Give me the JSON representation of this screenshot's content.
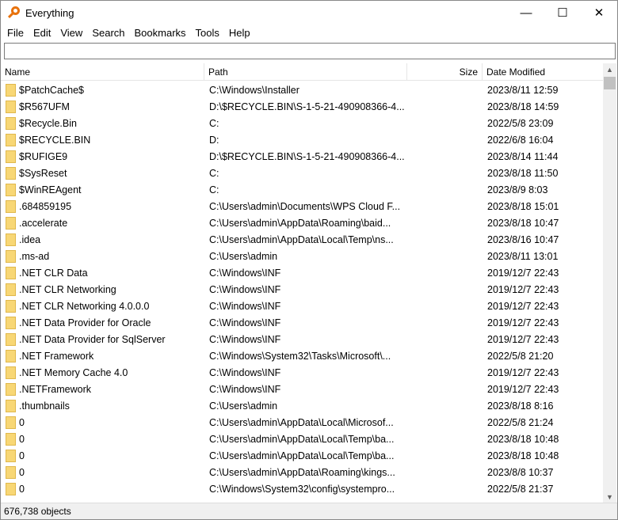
{
  "window": {
    "title": "Everything",
    "minimize": "—",
    "maximize": "☐",
    "close": "✕"
  },
  "menu": [
    "File",
    "Edit",
    "View",
    "Search",
    "Bookmarks",
    "Tools",
    "Help"
  ],
  "search": {
    "value": "",
    "placeholder": ""
  },
  "columns": {
    "name": "Name",
    "path": "Path",
    "size": "Size",
    "date": "Date Modified"
  },
  "rows": [
    {
      "name": "$PatchCache$",
      "path": "C:\\Windows\\Installer",
      "size": "",
      "date": "2023/8/11 12:59"
    },
    {
      "name": "$R567UFM",
      "path": "D:\\$RECYCLE.BIN\\S-1-5-21-490908366-4...",
      "size": "",
      "date": "2023/8/18 14:59"
    },
    {
      "name": "$Recycle.Bin",
      "path": "C:",
      "size": "",
      "date": "2022/5/8 23:09"
    },
    {
      "name": "$RECYCLE.BIN",
      "path": "D:",
      "size": "",
      "date": "2022/6/8 16:04"
    },
    {
      "name": "$RUFIGE9",
      "path": "D:\\$RECYCLE.BIN\\S-1-5-21-490908366-4...",
      "size": "",
      "date": "2023/8/14 11:44"
    },
    {
      "name": "$SysReset",
      "path": "C:",
      "size": "",
      "date": "2023/8/18 11:50"
    },
    {
      "name": "$WinREAgent",
      "path": "C:",
      "size": "",
      "date": "2023/8/9 8:03"
    },
    {
      "name": ".684859195",
      "path": "C:\\Users\\admin\\Documents\\WPS Cloud F...",
      "size": "",
      "date": "2023/8/18 15:01"
    },
    {
      "name": ".accelerate",
      "path": "C:\\Users\\admin\\AppData\\Roaming\\baid...",
      "size": "",
      "date": "2023/8/18 10:47"
    },
    {
      "name": ".idea",
      "path": "C:\\Users\\admin\\AppData\\Local\\Temp\\ns...",
      "size": "",
      "date": "2023/8/16 10:47"
    },
    {
      "name": ".ms-ad",
      "path": "C:\\Users\\admin",
      "size": "",
      "date": "2023/8/11 13:01"
    },
    {
      "name": ".NET CLR Data",
      "path": "C:\\Windows\\INF",
      "size": "",
      "date": "2019/12/7 22:43"
    },
    {
      "name": ".NET CLR Networking",
      "path": "C:\\Windows\\INF",
      "size": "",
      "date": "2019/12/7 22:43"
    },
    {
      "name": ".NET CLR Networking 4.0.0.0",
      "path": "C:\\Windows\\INF",
      "size": "",
      "date": "2019/12/7 22:43"
    },
    {
      "name": ".NET Data Provider for Oracle",
      "path": "C:\\Windows\\INF",
      "size": "",
      "date": "2019/12/7 22:43"
    },
    {
      "name": ".NET Data Provider for SqlServer",
      "path": "C:\\Windows\\INF",
      "size": "",
      "date": "2019/12/7 22:43"
    },
    {
      "name": ".NET Framework",
      "path": "C:\\Windows\\System32\\Tasks\\Microsoft\\...",
      "size": "",
      "date": "2022/5/8 21:20"
    },
    {
      "name": ".NET Memory Cache 4.0",
      "path": "C:\\Windows\\INF",
      "size": "",
      "date": "2019/12/7 22:43"
    },
    {
      "name": ".NETFramework",
      "path": "C:\\Windows\\INF",
      "size": "",
      "date": "2019/12/7 22:43"
    },
    {
      "name": ".thumbnails",
      "path": "C:\\Users\\admin",
      "size": "",
      "date": "2023/8/18 8:16"
    },
    {
      "name": "0",
      "path": "C:\\Users\\admin\\AppData\\Local\\Microsof...",
      "size": "",
      "date": "2022/5/8 21:24"
    },
    {
      "name": "0",
      "path": "C:\\Users\\admin\\AppData\\Local\\Temp\\ba...",
      "size": "",
      "date": "2023/8/18 10:48"
    },
    {
      "name": "0",
      "path": "C:\\Users\\admin\\AppData\\Local\\Temp\\ba...",
      "size": "",
      "date": "2023/8/18 10:48"
    },
    {
      "name": "0",
      "path": "C:\\Users\\admin\\AppData\\Roaming\\kings...",
      "size": "",
      "date": "2023/8/8 10:37"
    },
    {
      "name": "0",
      "path": "C:\\Windows\\System32\\config\\systempro...",
      "size": "",
      "date": "2022/5/8 21:37"
    }
  ],
  "status": {
    "count": "676,738 objects"
  },
  "colors": {
    "accent": "#e8720c",
    "folder": "#f8d775"
  }
}
